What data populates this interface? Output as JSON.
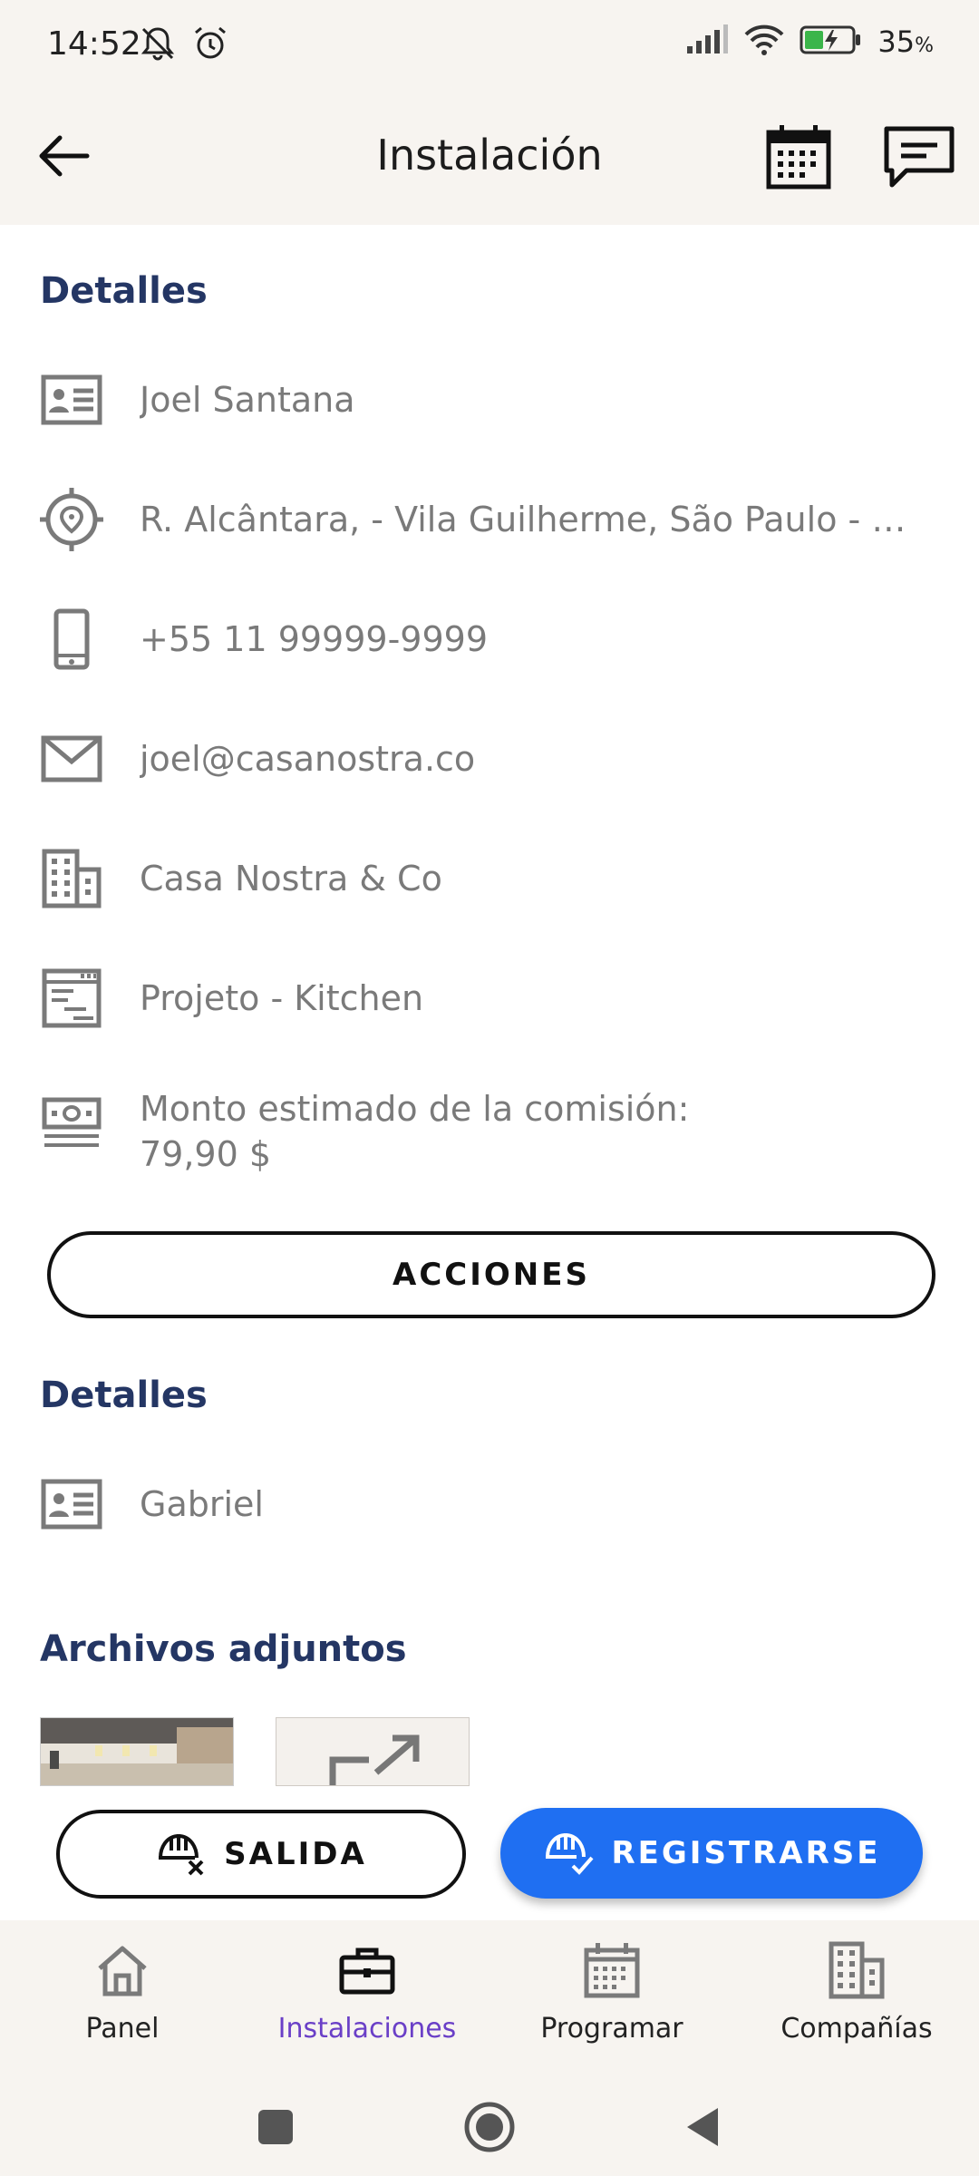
{
  "status_bar": {
    "time": "14:52",
    "battery": "35",
    "battery_unit": "%"
  },
  "app_bar": {
    "title": "Instalación"
  },
  "details": {
    "title": "Detalles",
    "rows": [
      {
        "icon": "contact-card-icon",
        "text": "Joel Santana"
      },
      {
        "icon": "location-pin-icon",
        "text": "R. Alcântara, - Vila Guilherme, São Paulo - SP, ..."
      },
      {
        "icon": "phone-icon",
        "text": "+55 11 99999-9999"
      },
      {
        "icon": "mail-icon",
        "text": "joel@casanostra.co"
      },
      {
        "icon": "building-icon",
        "text": "Casa Nostra & Co"
      },
      {
        "icon": "project-icon",
        "text": "Projeto - Kitchen"
      },
      {
        "icon": "money-icon",
        "text_line1": "Monto estimado de la comisión:",
        "text_line2": "79,90 $"
      }
    ]
  },
  "actions_button": "ACCIONES",
  "details2": {
    "title": "Detalles",
    "rows": [
      {
        "icon": "contact-card-icon",
        "text": "Gabriel"
      }
    ]
  },
  "attachments": {
    "title": "Archivos adjuntos"
  },
  "bottom_actions": {
    "salida": "SALIDA",
    "registrarse": "REGISTRARSE"
  },
  "bottom_nav": {
    "items": [
      {
        "label": "Panel",
        "icon": "home-icon",
        "active": false
      },
      {
        "label": "Instalaciones",
        "icon": "briefcase-icon",
        "active": true
      },
      {
        "label": "Programar",
        "icon": "calendar-icon",
        "active": false
      },
      {
        "label": "Compañías",
        "icon": "building-icon",
        "active": false
      }
    ]
  },
  "colors": {
    "section_title": "#243664",
    "primary_button": "#1f6ff2",
    "active_nav": "#6a3fc7"
  }
}
